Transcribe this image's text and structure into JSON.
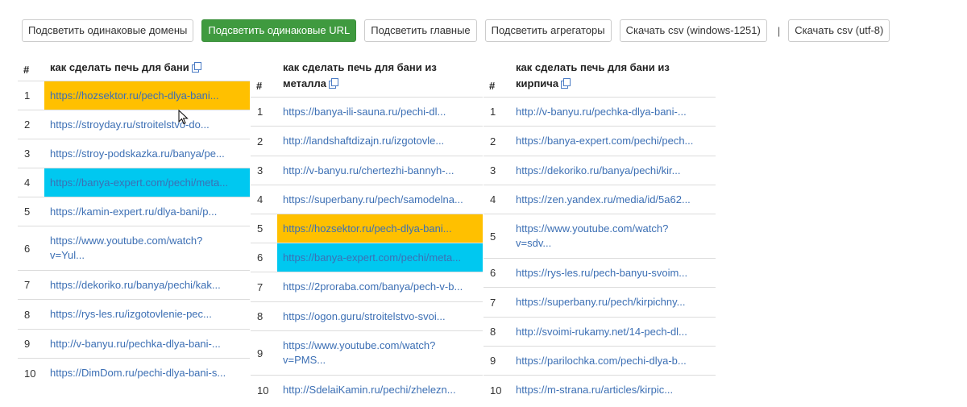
{
  "toolbar": {
    "btn_domains": "Подсветить одинаковые домены",
    "btn_urls": "Подсветить одинаковые URL",
    "btn_main": "Подсветить главные",
    "btn_aggregators": "Подсветить агрегаторы",
    "btn_csv_win": "Скачать csv (windows-1251)",
    "separator": "|",
    "btn_csv_utf": "Скачать csv (utf-8)"
  },
  "columns": [
    {
      "hash": "#",
      "query": "как сделать печь для бани",
      "rows": [
        {
          "n": "1",
          "url": "https://hozsektor.ru/pech-dlya-bani..."
        },
        {
          "n": "2",
          "url": "https://stroyday.ru/stroitelstvo-do..."
        },
        {
          "n": "3",
          "url": "https://stroy-podskazka.ru/banya/pe..."
        },
        {
          "n": "4",
          "url": "https://banya-expert.com/pechi/meta..."
        },
        {
          "n": "5",
          "url": "https://kamin-expert.ru/dlya-bani/p..."
        },
        {
          "n": "6",
          "url": "https://www.youtube.com/watch?v=Yul..."
        },
        {
          "n": "7",
          "url": "https://dekoriko.ru/banya/pechi/kak..."
        },
        {
          "n": "8",
          "url": "https://rys-les.ru/izgotovlenie-pec..."
        },
        {
          "n": "9",
          "url": "http://v-banyu.ru/pechka-dlya-bani-..."
        },
        {
          "n": "10",
          "url": "https://DimDom.ru/pechi-dlya-bani-s..."
        }
      ]
    },
    {
      "hash": "#",
      "query": "как сделать печь для бани из металла",
      "rows": [
        {
          "n": "1",
          "url": "https://banya-ili-sauna.ru/pechi-dl..."
        },
        {
          "n": "2",
          "url": "http://landshaftdizajn.ru/izgotovle..."
        },
        {
          "n": "3",
          "url": "http://v-banyu.ru/chertezhi-bannyh-..."
        },
        {
          "n": "4",
          "url": "https://superbany.ru/pech/samodelna..."
        },
        {
          "n": "5",
          "url": "https://hozsektor.ru/pech-dlya-bani..."
        },
        {
          "n": "6",
          "url": "https://banya-expert.com/pechi/meta..."
        },
        {
          "n": "7",
          "url": "https://2proraba.com/banya/pech-v-b..."
        },
        {
          "n": "8",
          "url": "https://ogon.guru/stroitelstvo-svoi..."
        },
        {
          "n": "9",
          "url": "https://www.youtube.com/watch?v=PMS..."
        },
        {
          "n": "10",
          "url": "http://SdelaiKamin.ru/pechi/zhelezn..."
        }
      ]
    },
    {
      "hash": "#",
      "query": "как сделать печь для бани из кирпича",
      "rows": [
        {
          "n": "1",
          "url": "http://v-banyu.ru/pechka-dlya-bani-..."
        },
        {
          "n": "2",
          "url": "https://banya-expert.com/pechi/pech..."
        },
        {
          "n": "3",
          "url": "https://dekoriko.ru/banya/pechi/kir..."
        },
        {
          "n": "4",
          "url": "https://zen.yandex.ru/media/id/5a62..."
        },
        {
          "n": "5",
          "url": "https://www.youtube.com/watch?v=sdv..."
        },
        {
          "n": "6",
          "url": "https://rys-les.ru/pech-banyu-svoim..."
        },
        {
          "n": "7",
          "url": "https://superbany.ru/pech/kirpichny..."
        },
        {
          "n": "8",
          "url": "http://svoimi-rukamy.net/14-pech-dl..."
        },
        {
          "n": "9",
          "url": "https://parilochka.com/pechi-dlya-b..."
        },
        {
          "n": "10",
          "url": "https://m-strana.ru/articles/kirpic..."
        }
      ]
    }
  ],
  "colors": {
    "highlight_yellow": "#ffc000",
    "highlight_cyan": "#00c8f0",
    "active_button": "#3f9a3f",
    "link": "#3c6fb4"
  }
}
